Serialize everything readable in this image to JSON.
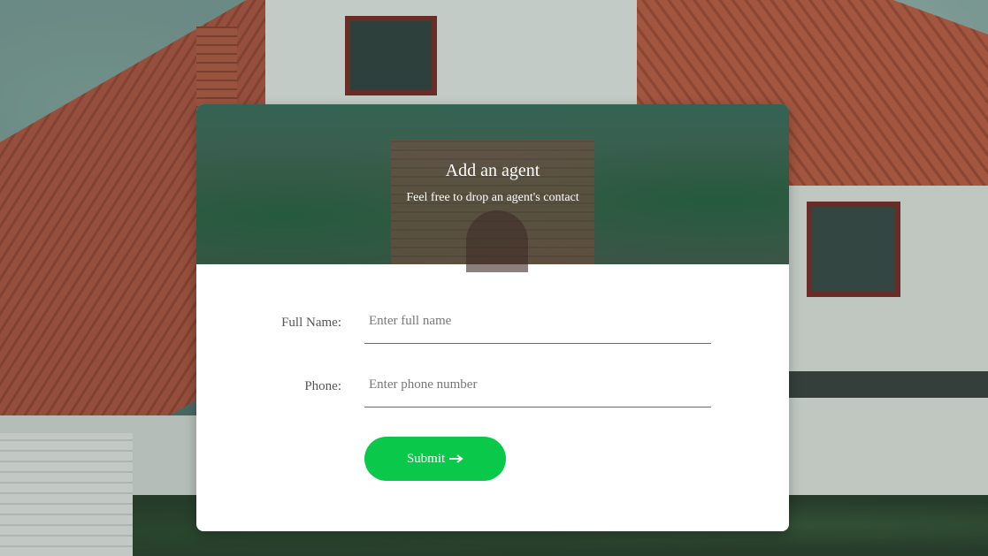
{
  "form": {
    "title": "Add an agent",
    "subtitle": "Feel free to drop an agent's contact",
    "full_name": {
      "label": "Full Name:",
      "value": "",
      "placeholder": "Enter full name"
    },
    "phone": {
      "label": "Phone:",
      "value": "",
      "placeholder": "Enter phone number"
    },
    "submit": {
      "label": "Submit",
      "icon": "arrow-right-icon"
    }
  },
  "colors": {
    "submit_button": "#0ac94a",
    "header_overlay": "#1e5a46",
    "input_underline": "#6b6b6b",
    "label_text": "#555555"
  }
}
